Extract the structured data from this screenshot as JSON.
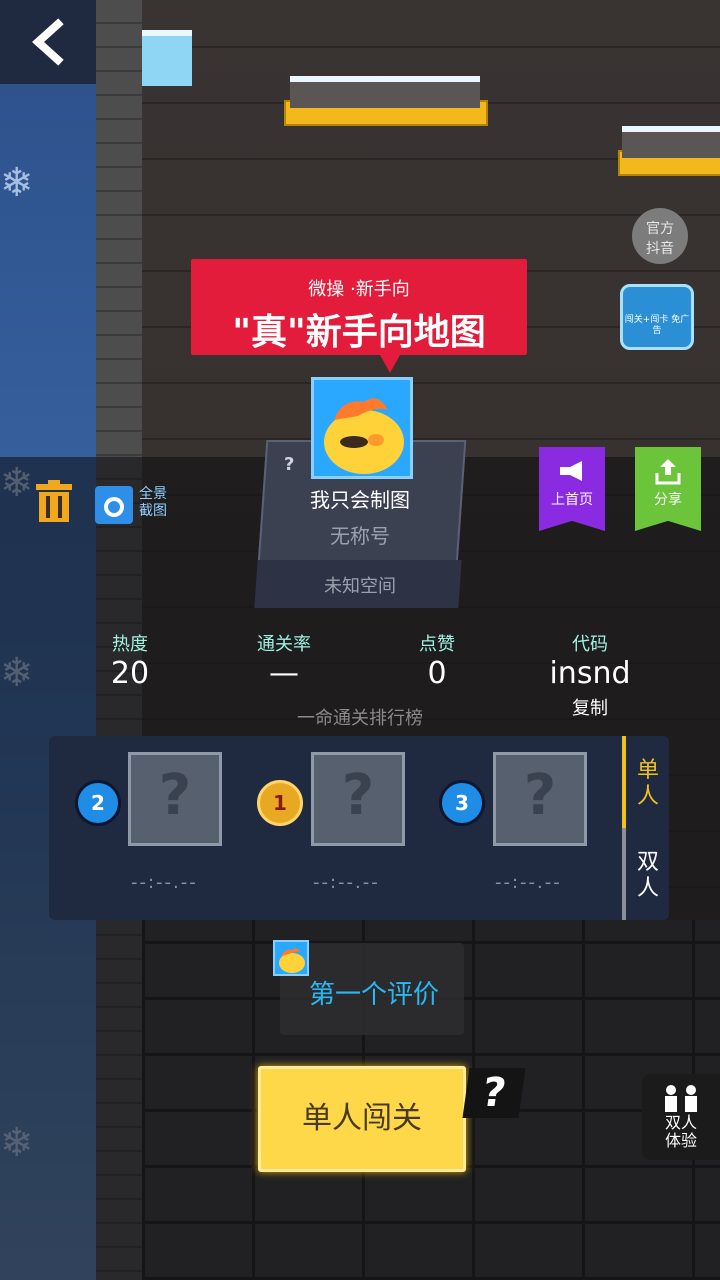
{
  "banner": {
    "subtitle": "微操 ·新手向",
    "title": "\"真\"新手向地图"
  },
  "author": {
    "question_mark": "?",
    "name": "我只会制图",
    "title": "无称号",
    "space": "未知空间"
  },
  "top_right": {
    "official_line1": "官方",
    "official_line2": "抖音",
    "ad_label": "闯关+闯卡 免广告"
  },
  "left_tools": {
    "screenshot_label_1": "全景",
    "screenshot_label_2": "截图"
  },
  "actions": {
    "homepage": "上首页",
    "share": "分享"
  },
  "stats": {
    "heat_label": "热度",
    "heat_value": "20",
    "clear_rate_label": "通关率",
    "clear_rate_value": "—",
    "likes_label": "点赞",
    "likes_value": "0",
    "code_label": "代码",
    "code_value": "insnd",
    "copy_label": "复制"
  },
  "leaderboard": {
    "title": "一命通关排行榜",
    "entries": [
      {
        "rank": "2",
        "time": "--:--.--"
      },
      {
        "rank": "1",
        "time": "--:--.--"
      },
      {
        "rank": "3",
        "time": "--:--.--"
      }
    ],
    "tabs": [
      {
        "label": "单人"
      },
      {
        "label": "双人"
      }
    ],
    "active_tab": "单人"
  },
  "comment": {
    "label": "第一个评价"
  },
  "play_button": {
    "label": "单人闯关"
  },
  "help": {
    "label": "?"
  },
  "duo_trial": {
    "line1": "双人",
    "line2": "体验"
  },
  "colors": {
    "banner_red": "#e21c3a",
    "homepage_purple": "#8a2be2",
    "share_green": "#6cc43a",
    "play_yellow": "#ffd84a",
    "accent_cyan": "#2aa7ff"
  }
}
